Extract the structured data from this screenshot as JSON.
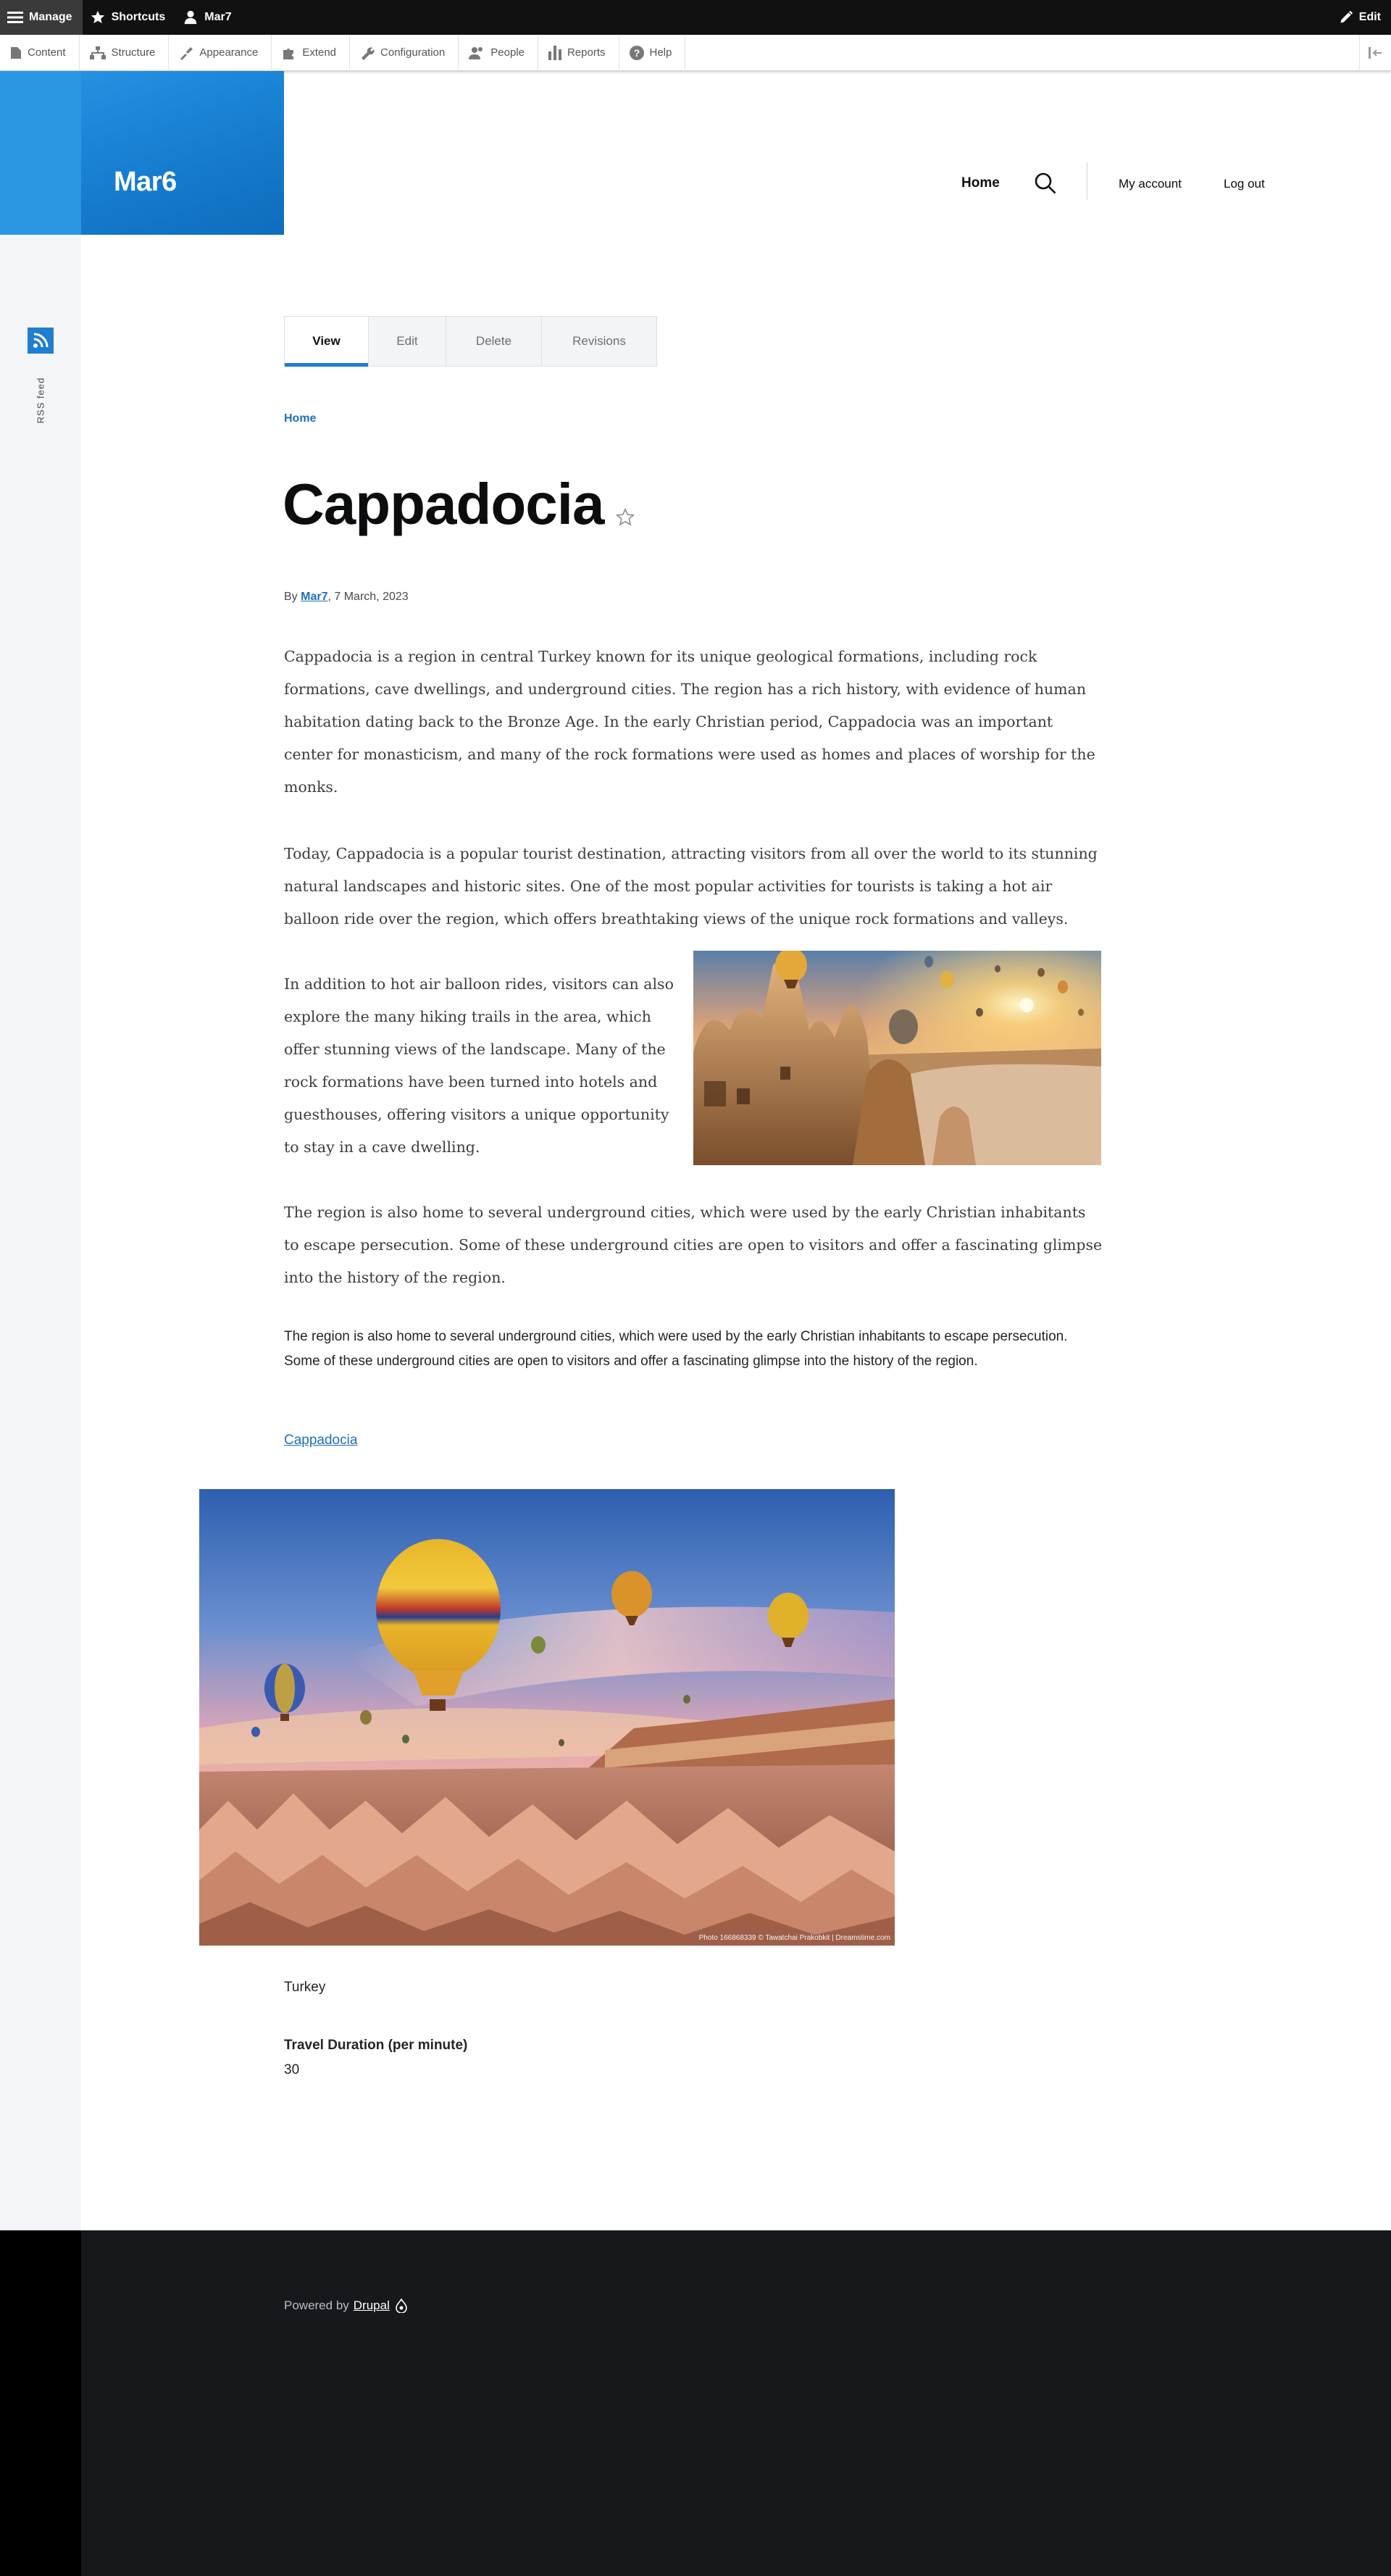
{
  "toolbar": {
    "manage": "Manage",
    "shortcuts": "Shortcuts",
    "user": "Mar7",
    "edit": "Edit"
  },
  "tray": {
    "items": [
      "Content",
      "Structure",
      "Appearance",
      "Extend",
      "Configuration",
      "People",
      "Reports",
      "Help"
    ]
  },
  "site": {
    "name": "Mar6"
  },
  "nav": {
    "home": "Home",
    "my_account": "My account",
    "log_out": "Log out"
  },
  "rss": {
    "label": "RSS feed"
  },
  "tabs": [
    "View",
    "Edit",
    "Delete",
    "Revisions"
  ],
  "breadcrumb": {
    "home": "Home"
  },
  "article": {
    "title": "Cappadocia",
    "by": "By ",
    "author": "Mar7",
    "date": ", 7 March, 2023",
    "paragraphs": [
      "Cappadocia is a region in central Turkey known for its unique geological formations, including rock formations, cave dwellings, and underground cities. The region has a rich history, with evidence of human habitation dating back to the Bronze Age. In the early Christian period, Cappadocia was an important center for monasticism, and many of the rock formations were used as homes and places of worship for the monks.",
      "Today, Cappadocia is a popular tourist destination, attracting visitors from all over the world to its stunning natural landscapes and historic sites. One of the most popular activities for tourists is taking a hot air balloon ride over the region, which offers breathtaking views of the unique rock formations and valleys.",
      "In addition to hot air balloon rides, visitors can also explore the many hiking trails in the area, which offer stunning views of the landscape. Many of the rock formations have been turned into hotels and guesthouses, offering visitors a unique opportunity to stay in a cave dwelling.",
      "The region is also home to several underground cities, which were used by the early Christian inhabitants to escape persecution. Some of these underground cities are open to visitors and offer a fascinating glimpse into the history of the region."
    ],
    "summary": "The region is also home to several underground cities, which were used by the early Christian inhabitants to escape persecution. Some of these underground cities are open to visitors and offer a fascinating glimpse into the history of the region.",
    "tag": "Cappadocia",
    "photo_credit": "Photo 166868339 © Tawatchai Prakobkit | Dreamstime.com",
    "country": "Turkey",
    "field_label": "Travel Duration (per minute)",
    "field_value": "30"
  },
  "footer": {
    "powered_by": "Powered by",
    "drupal": "Drupal"
  },
  "colors": {
    "brand_blue": "#1f7ed0",
    "toolbar_dark": "#111111",
    "footer_dark": "#16181b",
    "link": "#1f6fba"
  }
}
